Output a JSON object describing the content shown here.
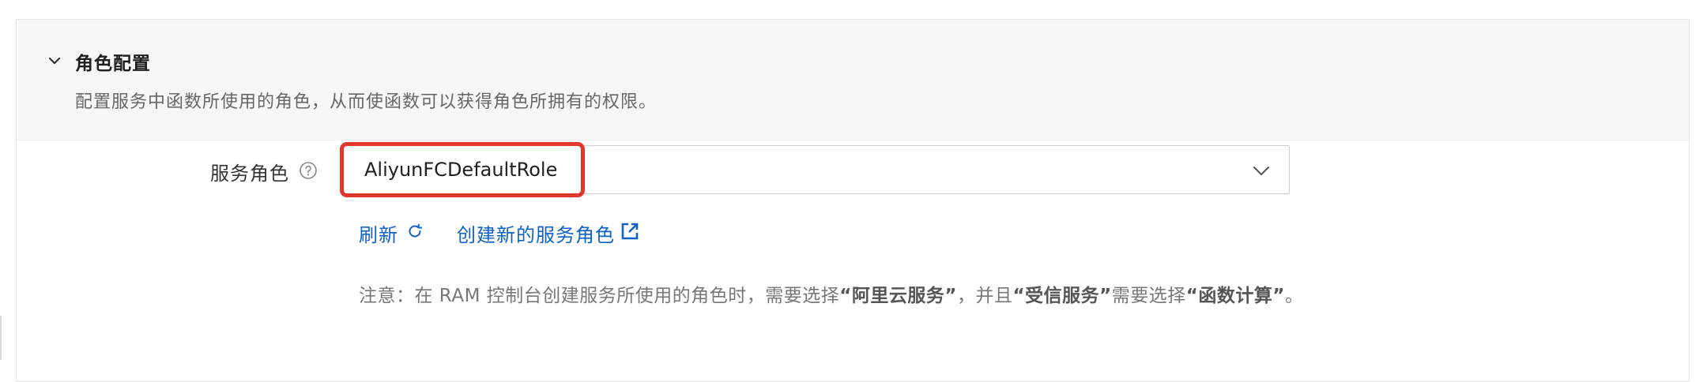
{
  "section": {
    "title": "角色配置",
    "description": "配置服务中函数所使用的角色，从而使函数可以获得角色所拥有的权限。",
    "expanded": true
  },
  "service_role": {
    "label": "服务角色",
    "help_icon": "question-circle-icon",
    "selected_value": "AliyunFCDefaultRole",
    "highlight_color": "#e2372b"
  },
  "actions": {
    "refresh_label": "刷新",
    "refresh_icon": "refresh-icon",
    "create_role_label": "创建新的服务角色",
    "create_role_icon": "external-link-icon",
    "link_color": "#0e62c8"
  },
  "note": {
    "part1": "注意：在 RAM 控制台创建服务所使用的角色时，需要选择",
    "bold1": "“阿里云服务”",
    "part2": "，并且",
    "bold2": "“受信服务”",
    "part3": "需要选择",
    "bold3": "“函数计算”",
    "part4": "。"
  }
}
